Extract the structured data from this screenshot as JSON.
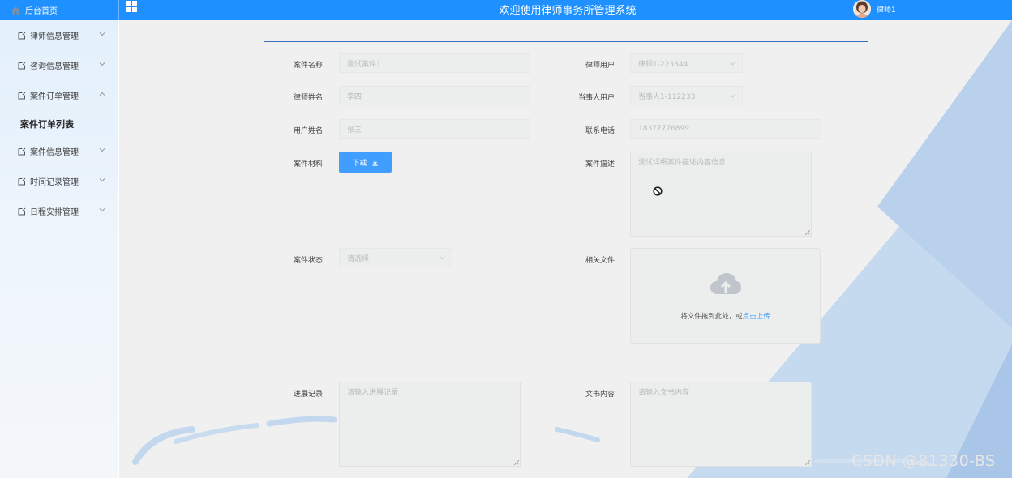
{
  "header": {
    "home_label": "后台首页",
    "title": "欢迎使用律师事务所管理系统",
    "user_name": "律师1"
  },
  "sidebar": {
    "items": [
      {
        "label": "律师信息管理"
      },
      {
        "label": "咨询信息管理"
      },
      {
        "label": "案件订单管理"
      },
      {
        "label": "案件信息管理"
      },
      {
        "label": "时间记录管理"
      },
      {
        "label": "日程安排管理"
      }
    ],
    "submenu": {
      "label": "案件订单列表"
    }
  },
  "form": {
    "case_name": {
      "label": "案件名称",
      "value": "测试案件1"
    },
    "lawyer_user": {
      "label": "律师用户",
      "value": "律师1-223344"
    },
    "lawyer_name": {
      "label": "律师姓名",
      "value": "李四"
    },
    "client_user": {
      "label": "当事人用户",
      "value": "当事人1-112233"
    },
    "user_name": {
      "label": "用户姓名",
      "value": "张三"
    },
    "phone": {
      "label": "联系电话",
      "value": "18377776899"
    },
    "material": {
      "label": "案件材料",
      "button": "下载"
    },
    "description": {
      "label": "案件描述",
      "value": "测试详细案件描述内容信息"
    },
    "status": {
      "label": "案件状态",
      "placeholder": "请选择"
    },
    "files": {
      "label": "相关文件",
      "drop_text": "将文件拖到此处，或",
      "click_text": "点击上传"
    },
    "progress": {
      "label": "进展记录",
      "placeholder": "请输入进展记录"
    },
    "document": {
      "label": "文书内容",
      "placeholder": "请输入文书内容"
    }
  },
  "watermark": "CSDN @81330-BS",
  "colors": {
    "header": "#1e90ff",
    "button": "#409eff",
    "panel_border": "#3a70c0"
  }
}
